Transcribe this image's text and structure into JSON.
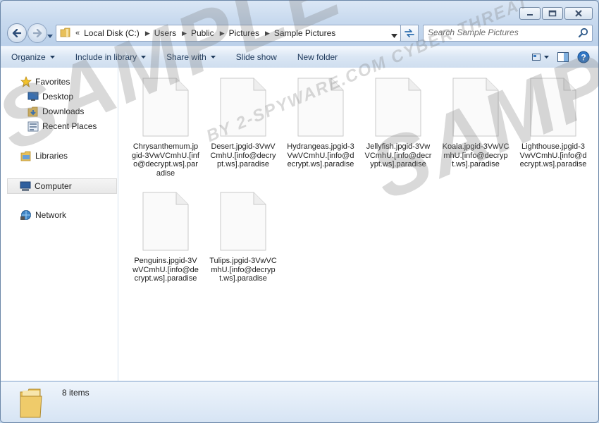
{
  "window": {
    "minimize_icon": "minimize-icon",
    "maximize_icon": "maximize-icon",
    "close_icon": "close-icon"
  },
  "address_bar": {
    "overflow": "«",
    "breadcrumbs": [
      "Local Disk (C:)",
      "Users",
      "Public",
      "Pictures",
      "Sample Pictures"
    ],
    "search_placeholder": "Search Sample Pictures"
  },
  "toolbar": {
    "organize": "Organize",
    "include_in_library": "Include in library",
    "share_with": "Share with",
    "slide_show": "Slide show",
    "new_folder": "New folder"
  },
  "nav": {
    "favorites": "Favorites",
    "desktop": "Desktop",
    "downloads": "Downloads",
    "recent_places": "Recent Places",
    "libraries": "Libraries",
    "computer": "Computer",
    "network": "Network"
  },
  "files": [
    "Chrysanthemum.jpgid-3VwVCmhU.[info@decrypt.ws].paradise",
    "Desert.jpgid-3VwVCmhU.[info@decrypt.ws].paradise",
    "Hydrangeas.jpgid-3VwVCmhU.[info@decrypt.ws].paradise",
    "Jellyfish.jpgid-3VwVCmhU.[info@decrypt.ws].paradise",
    "Koala.jpgid-3VwVCmhU.[info@decrypt.ws].paradise",
    "Lighthouse.jpgid-3VwVCmhU.[info@decrypt.ws].paradise",
    "Penguins.jpgid-3VwVCmhU.[info@decrypt.ws].paradise",
    "Tulips.jpgid-3VwVCmhU.[info@decrypt.ws].paradise"
  ],
  "status": {
    "item_count": "8 items"
  },
  "watermark": {
    "main": "SAMPLE",
    "sub": "BY 2-SPYWARE.COM  CYBER THREAT"
  }
}
